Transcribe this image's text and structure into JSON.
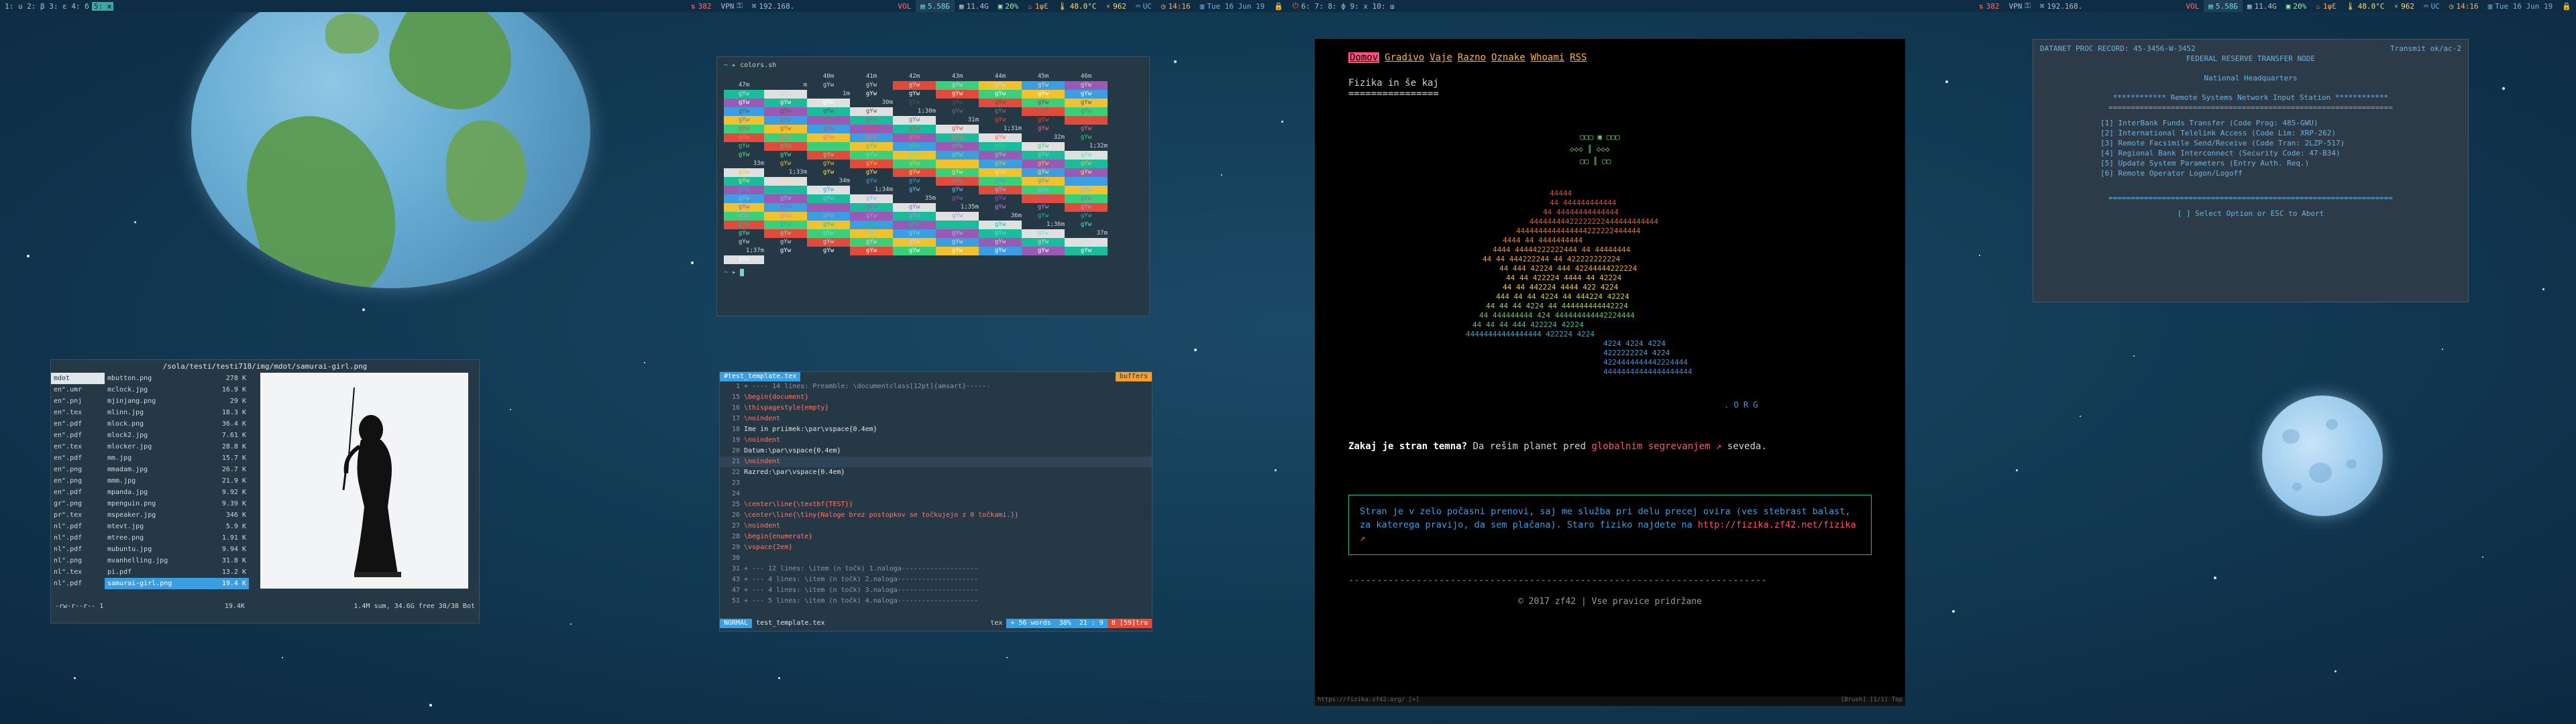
{
  "bar": {
    "left_workspaces": "1: u 2: β 3: ε 4: б",
    "active_workspace": "5: ж",
    "net_down": "382",
    "vpn": "VPN",
    "ip": "192.168.",
    "vol": "VOL",
    "disk1": "5.58Ƃ",
    "mem": "11.4G",
    "cpu": "20%",
    "load": "1ψƐ",
    "temp": "48.0°C",
    "bat": "962",
    "kbd": "UC",
    "time": "14:16",
    "date": "Tue 16 Jun 19",
    "right_workspaces": "6: 7: 8: ф 9: x 10: ш"
  },
  "colors_term": {
    "prompt": "~",
    "command": "colors.sh",
    "headers": [
      "",
      "",
      "40m",
      "41m",
      "42m",
      "43m",
      "44m",
      "45m",
      "46m",
      "47m"
    ],
    "row_labels": [
      "m",
      "1m",
      "30m",
      "1;30m",
      "31m",
      "1;31m",
      "32m",
      "1;32m",
      "33m",
      "1;33m",
      "34m",
      "1;34m",
      "35m",
      "1;35m",
      "36m",
      "1;36m",
      "37m",
      "1;37m"
    ],
    "cell_text": "gYw",
    "bg_colors": [
      "#253846",
      "#253846",
      "#e24a3b",
      "#3ad07a",
      "#f2c12e",
      "#3a9ee0",
      "#9b59b6",
      "#1abc9c",
      "#e0e0e0"
    ]
  },
  "ranger": {
    "path": "/sola/testi/testi718/img/mdot/samurai-girl.png",
    "left_col": [
      "mdot",
      "en\".umr",
      "en\".pnj",
      "en\".tex",
      "en\".pdf",
      "en\".pdf",
      "en\".tex",
      "en\".pdf",
      "en\".png",
      "en\".png",
      "en\".pdf",
      "gr\".png",
      "pr\".tex",
      "nl\".pdf",
      "nl\".pdf",
      "nl\".pdf",
      "nl\".png",
      "nl\".tex",
      "nl\".pdf"
    ],
    "files": [
      {
        "name": "mbutton.png",
        "size": "278 K"
      },
      {
        "name": "mclock.jpg",
        "size": "16.9 K"
      },
      {
        "name": "mjinjang.png",
        "size": "29 K"
      },
      {
        "name": "mlinn.jpg",
        "size": "18.3 K"
      },
      {
        "name": "mlock.png",
        "size": "36.4 K"
      },
      {
        "name": "mlock2.jpg",
        "size": "7.61 K"
      },
      {
        "name": "mlocker.jpg",
        "size": "28.8 K"
      },
      {
        "name": "mm.jpg",
        "size": "15.7 K"
      },
      {
        "name": "mmadam.jpg",
        "size": "26.7 K"
      },
      {
        "name": "mmm.jpg",
        "size": "21.9 K"
      },
      {
        "name": "mpanda.jpg",
        "size": "9.92 K"
      },
      {
        "name": "mpenguin.png",
        "size": "9.39 K"
      },
      {
        "name": "mspeaker.jpg",
        "size": "346 K"
      },
      {
        "name": "mtevt.jpg",
        "size": "5.9 K"
      },
      {
        "name": "mtree.png",
        "size": "1.91 K"
      },
      {
        "name": "mubuntu.jpg",
        "size": "9.94 K"
      },
      {
        "name": "mvanhelling.jpg",
        "size": "31.8 K"
      },
      {
        "name": "pi.pdf",
        "size": "13.2 K"
      },
      {
        "name": "samurai-girl.png",
        "size": "19.4 K"
      }
    ],
    "status_left": "-rw-r--r-- 1",
    "status_size": "19.4K",
    "status_right": "1.4M sum, 34.6G free  38/38  Bot"
  },
  "vim": {
    "tab": "#test_template.tex",
    "buffers": "buffers",
    "lines": [
      {
        "n": "1",
        "t": "+ ---- 14 lines: Preamble: \\documentclass[12pt]{amsart}------"
      },
      {
        "n": "15",
        "t": "\\begin{document}"
      },
      {
        "n": "16",
        "t": "\\thispagestyle{empty}"
      },
      {
        "n": "17",
        "t": "\\noindent"
      },
      {
        "n": "18",
        "t": "Ime in priimek:\\par\\vspace{0.4em}"
      },
      {
        "n": "19",
        "t": "\\noindent"
      },
      {
        "n": "20",
        "t": "Datum:\\par\\vspace{0.4em}"
      },
      {
        "n": "21",
        "t": "\\noindent"
      },
      {
        "n": "22",
        "t": "Razred:\\par\\vspace{0.4em}"
      },
      {
        "n": "23",
        "t": ""
      },
      {
        "n": "24",
        "t": ""
      },
      {
        "n": "25",
        "t": "\\center\\line{\\textbf{TEST}}"
      },
      {
        "n": "26",
        "t": "\\center\\line{\\tiny{Naloge brez postopkov se točkujejo z 0 točkami.}}"
      },
      {
        "n": "27",
        "t": "\\noindent"
      },
      {
        "n": "28",
        "t": "\\begin{enumerate}"
      },
      {
        "n": "29",
        "t": "\\vspace{2em}"
      },
      {
        "n": "30",
        "t": ""
      },
      {
        "n": "31",
        "t": "+ --- 12 lines: \\item (n točk) 1.naloga-------------------"
      },
      {
        "n": "43",
        "t": "+ --- 4 lines: \\item (n točk) 2.naloga--------------------"
      },
      {
        "n": "47",
        "t": "+ --- 4 lines: \\item (n točk) 3.naloga--------------------"
      },
      {
        "n": "51",
        "t": "+ --- 5 lines: \\item (n točk) 4.naloga--------------------"
      }
    ],
    "mode": "NORMAL",
    "file": "test_template.tex",
    "ft": "tex",
    "words": "+ 56 words",
    "pct": "38%",
    "pos": "21 : 9",
    "err": "8 [59]tra"
  },
  "web": {
    "nav": [
      "Domov",
      "Gradivo",
      "Vaje",
      "Razno",
      "Oznake",
      "Whoami",
      "RSS"
    ],
    "heading": "Fizika in še kaj",
    "underline": "================",
    "question_bold": "Zakaj je stran temna?",
    "question_rest": " Da rešim planet pred ",
    "question_link": "globalnim segrevanjem",
    "question_tail": " seveda.",
    "notice": "Stran je v zelo počasni prenovi, saj me služba pri delu precej ovira (ves stebrast balast, za katerega pravijo, da sem plačana). Staro fiziko najdete na ",
    "notice_link": "http://fizika.zf42.net/fizika",
    "footer_rule": "--------------------------------------------------------------------------",
    "footer": "© 2017 zf42 | Vse pravice pridržane",
    "status_url": "https://fizika.zf42.org/ [+]",
    "status_right": "[Brush] [1/1] Top",
    "logo_text": ". O R G"
  },
  "bank": {
    "header_left": "DATANET PROC RECORD:  45-3456-W-3452",
    "header_right": "Transmit ok/ac-2",
    "title": "FEDERAL RESERVE TRANSFER NODE",
    "subtitle": "National Headquarters",
    "station": "************  Remote Systems Network Input Station  ************",
    "rule1": "================================================================",
    "items": [
      "[1] InterBank Funds Transfer  (Code Prog: 485-GWU)",
      "[2] International Telelink Access  (Code Lim: XRP-262)",
      "[3] Remote Facsimile Send/Receive  (Code Tran: 2LZP-517)",
      "[4] Regional Bank Interconnect  (Security Code: 47-B34)",
      "[5] Update System Parameters  (Entry Auth. Req.)",
      "[6] Remote Operator Logon/Logoff"
    ],
    "rule2": "================================================================",
    "select": "[ ] Select Option or ESC to Abort"
  },
  "colors": {
    "accent": "#3ea8a0",
    "web_link": "#ff4f7b",
    "notice_border": "#1abc9c"
  }
}
